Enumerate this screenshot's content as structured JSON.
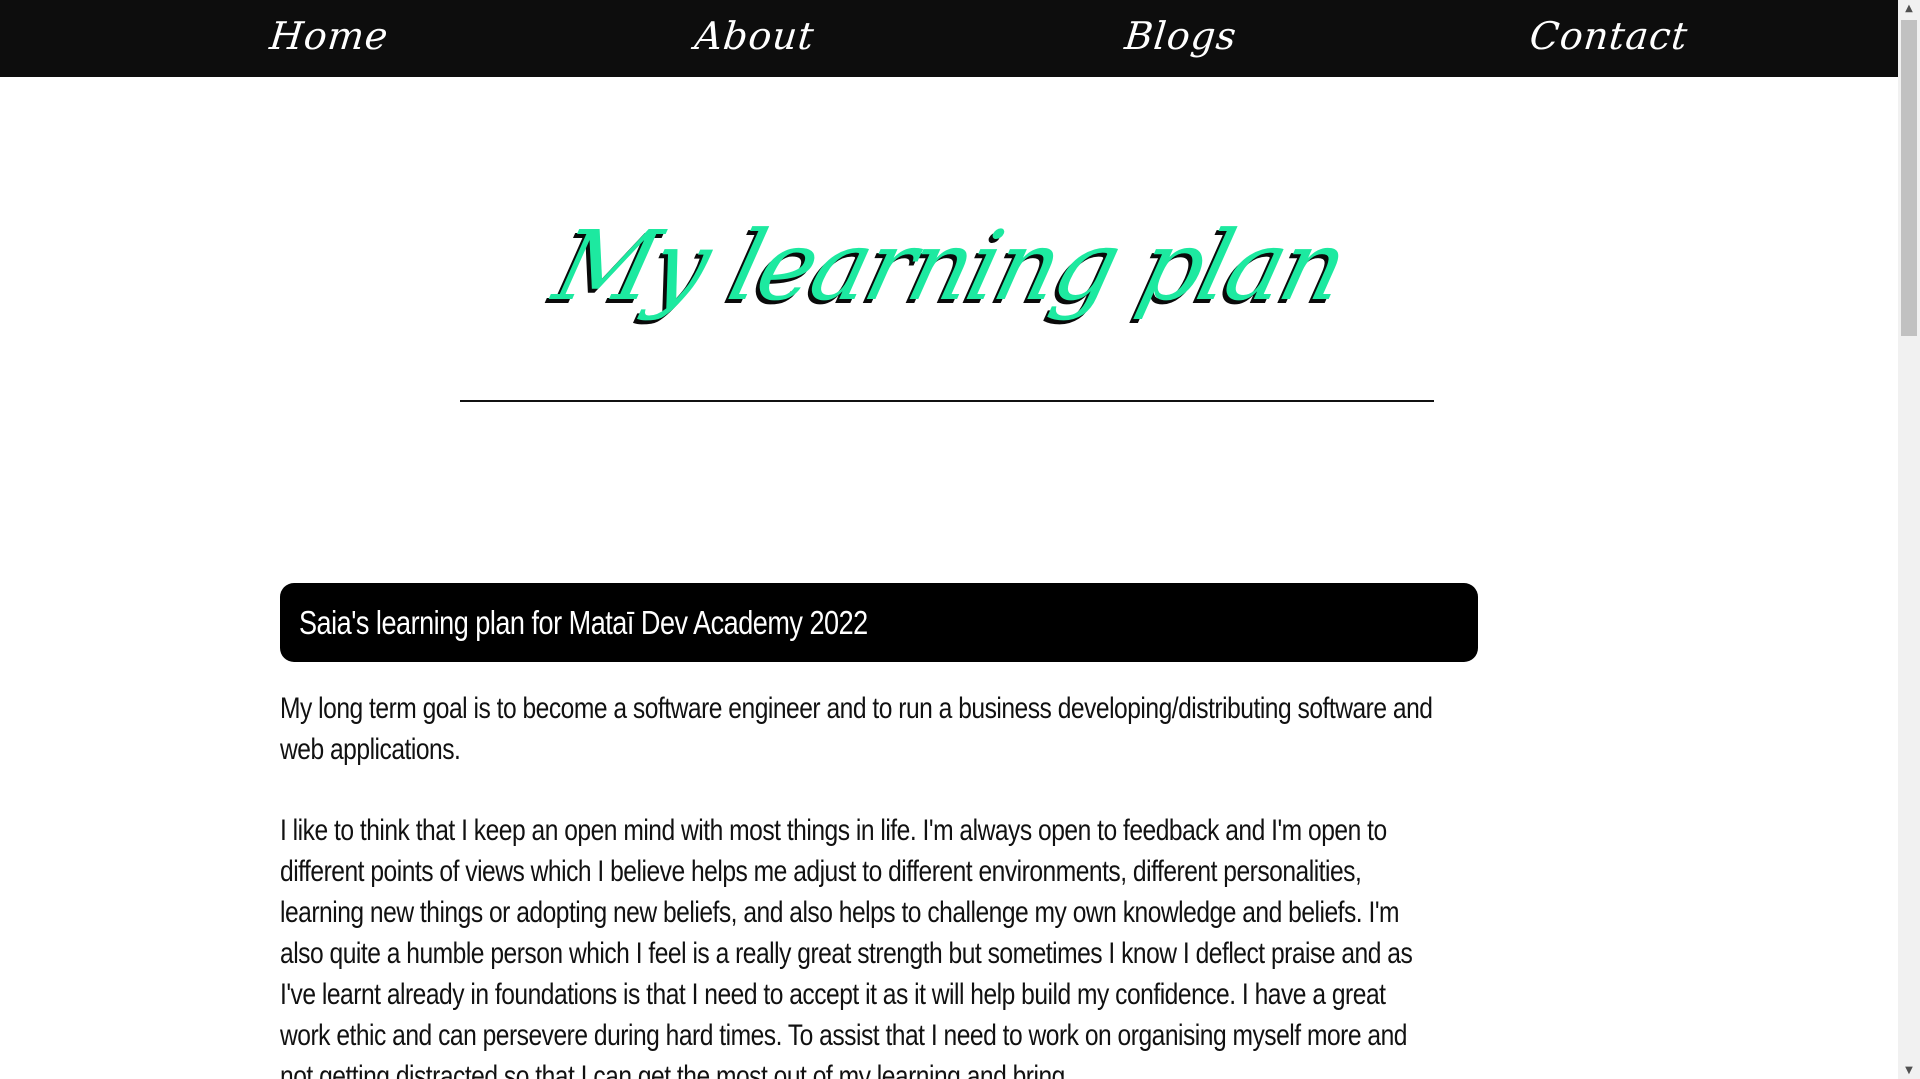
{
  "nav": {
    "home": "Home",
    "about": "About",
    "blogs": "Blogs",
    "contact": "Contact"
  },
  "page": {
    "title": "My learning plan"
  },
  "plan": {
    "heading": "Saia's learning plan for Mataī Dev Academy 2022",
    "paragraphs": [
      "My long term goal is to become a software engineer and to run a business developing/distributing software and web applications.",
      "I like to think that I keep an open mind with most things in life. I'm always open to feedback and I'm open to different points of views which I believe helps me adjust to different environments, different personalities, learning new things or adopting new beliefs, and also helps to challenge my own knowledge and beliefs. I'm also quite a humble person which I feel is a really great strength but sometimes I know I deflect praise and as I've learnt already in foundations is that I need to accept it as it will help build my confidence. I have a great work ethic and can persevere during hard times. To assist that I need to work on organising myself more and not getting distracted so that I can get the most out of my learning and bring"
    ]
  },
  "scrollbar": {
    "up_arrow": "▲",
    "down_arrow": "▼"
  },
  "colors": {
    "nav_background": "#0d0d0d",
    "title_accent": "#1de9a0",
    "header_background": "#000000",
    "text": "#111111"
  }
}
